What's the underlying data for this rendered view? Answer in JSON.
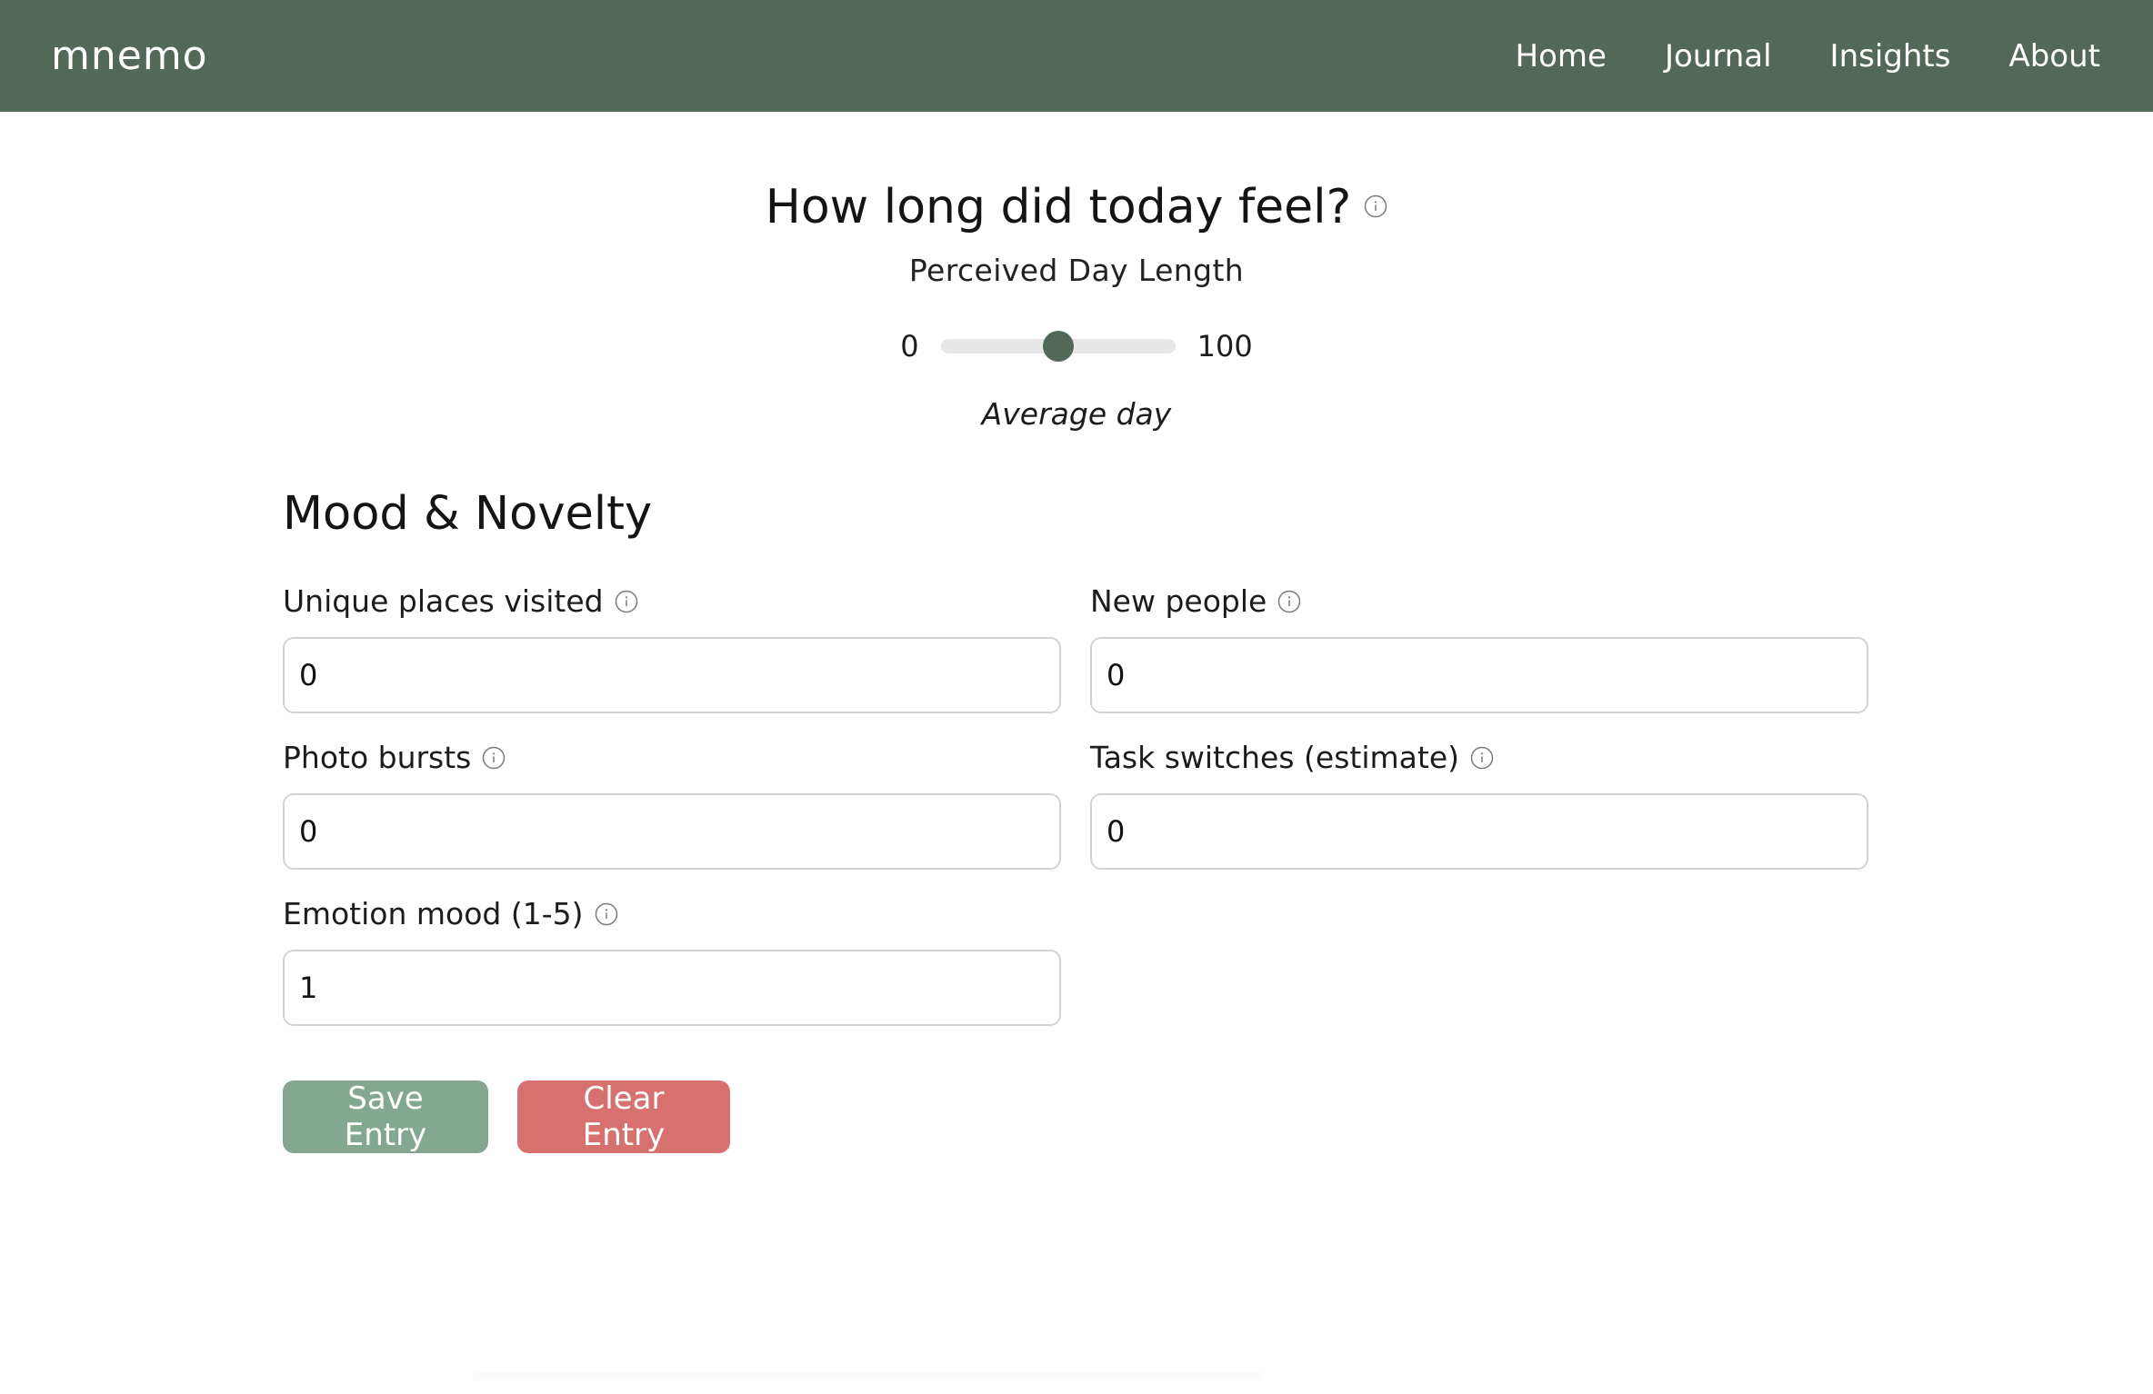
{
  "header": {
    "brand": "mnemo",
    "nav": [
      "Home",
      "Journal",
      "Insights",
      "About"
    ]
  },
  "hero": {
    "title": "How long did today feel?",
    "subtitle": "Perceived Day Length",
    "slider": {
      "min_label": "0",
      "max_label": "100",
      "value": 50,
      "caption": "Average day"
    }
  },
  "section": {
    "title": "Mood & Novelty",
    "fields": [
      {
        "label": "Unique places visited",
        "value": "0"
      },
      {
        "label": "New people",
        "value": "0"
      },
      {
        "label": "Photo bursts",
        "value": "0"
      },
      {
        "label": "Task switches (estimate)",
        "value": "0"
      },
      {
        "label": "Emotion mood (1-5)",
        "value": "1"
      }
    ]
  },
  "actions": {
    "save_label": "Save Entry",
    "clear_label": "Clear Entry"
  },
  "colors": {
    "header_bg": "#52695a",
    "save_bg": "#84a791",
    "clear_bg": "#d7716f",
    "slider_thumb": "#52695a"
  },
  "icons": {
    "info": "info-circle-icon"
  }
}
